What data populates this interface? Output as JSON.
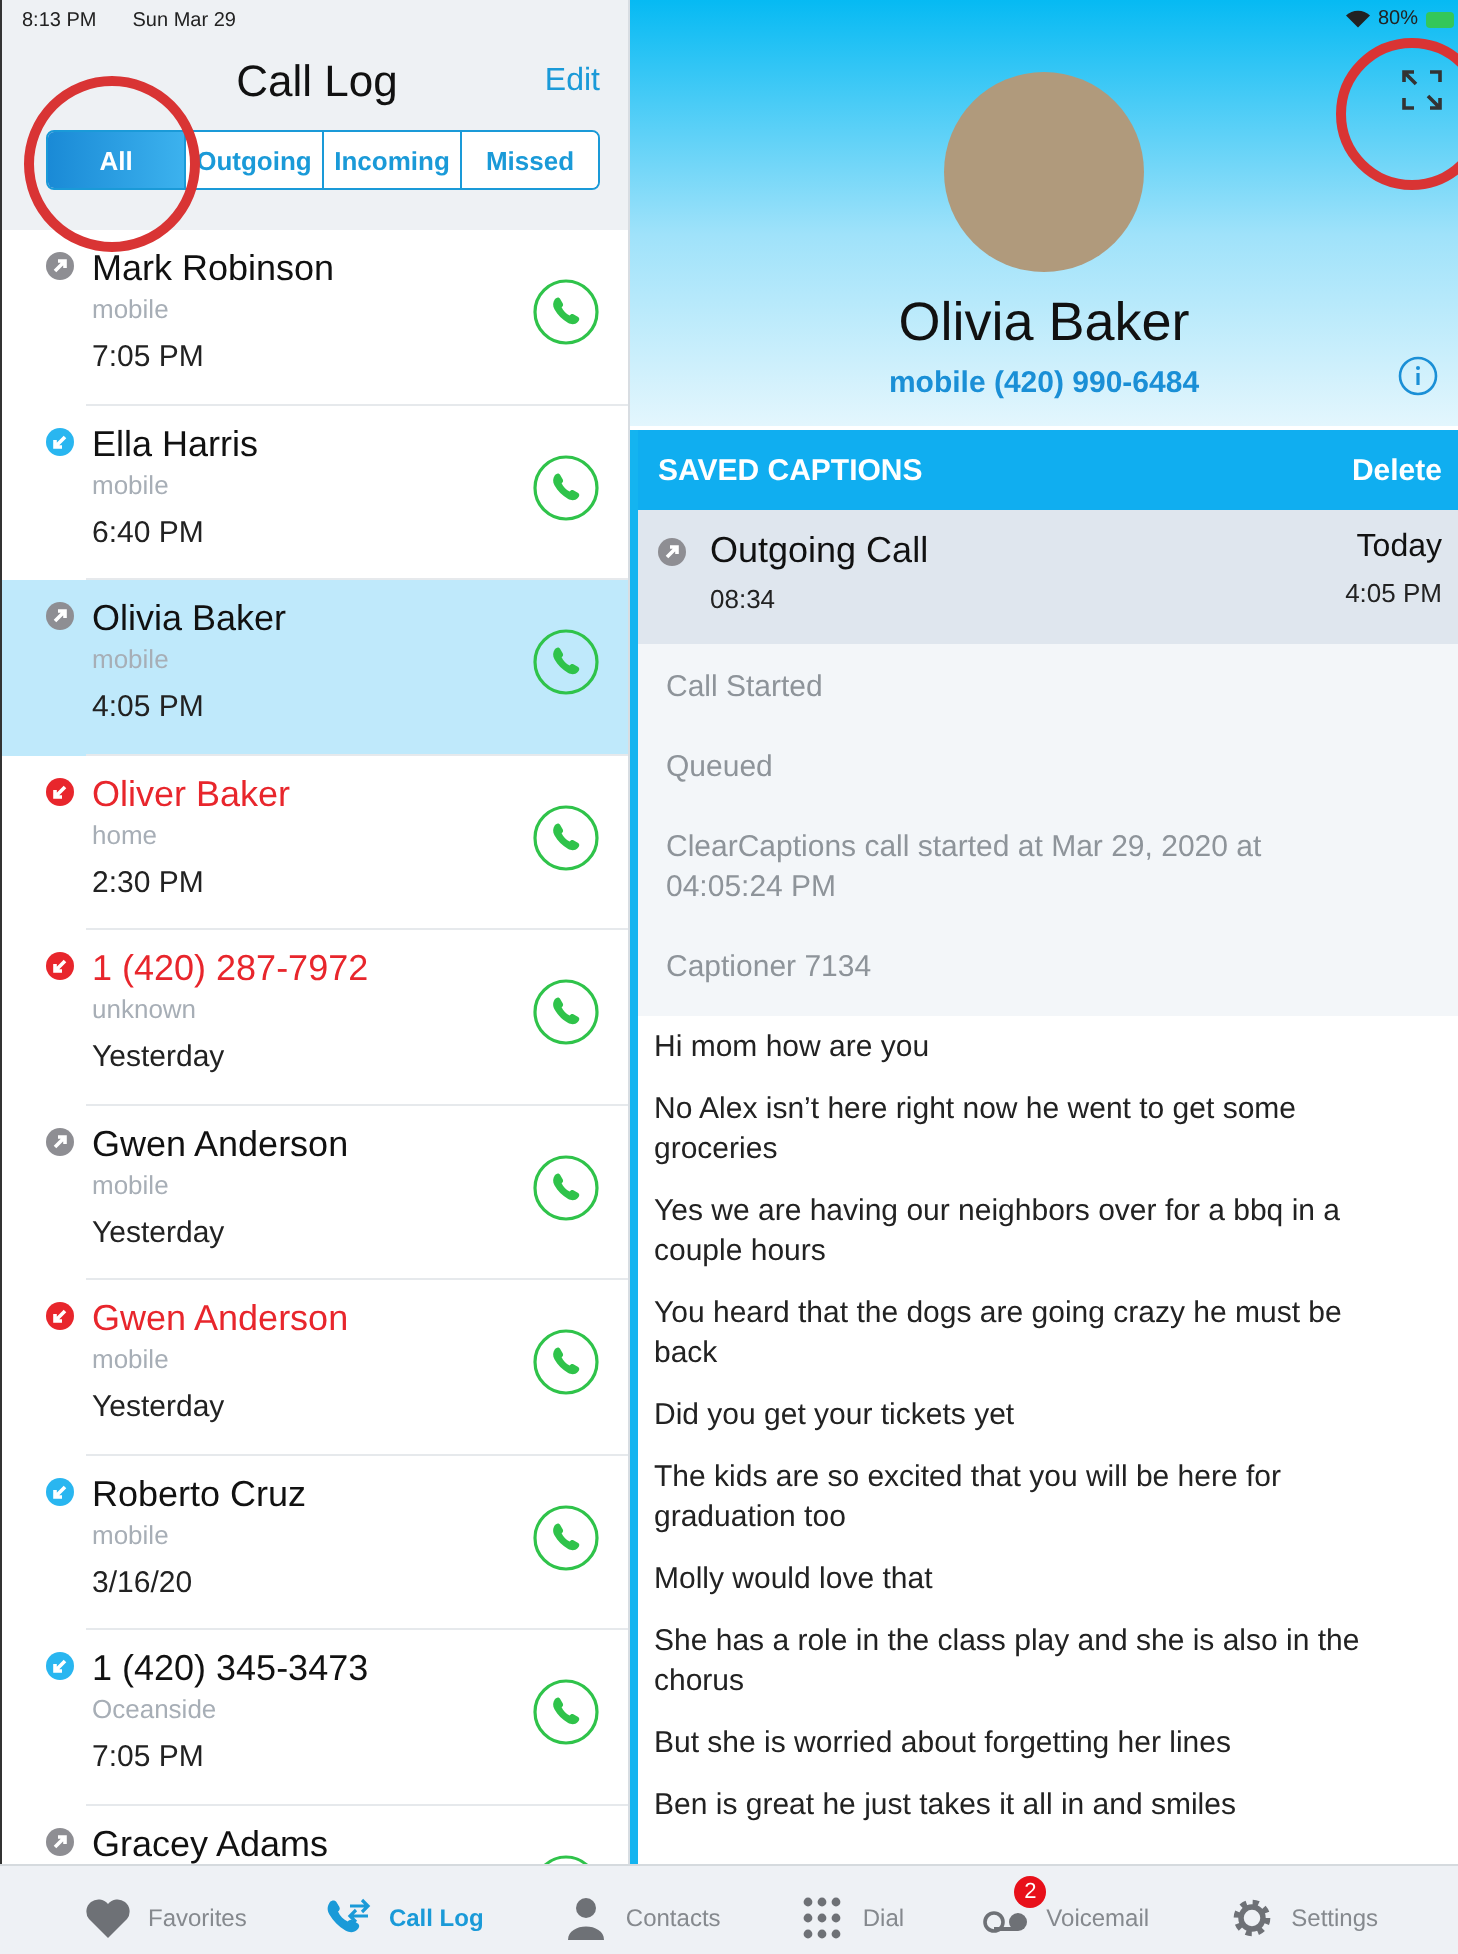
{
  "status_bar": {
    "time": "8:13 PM",
    "date": "Sun Mar 29",
    "battery": "80%"
  },
  "call_log": {
    "title": "Call Log",
    "edit": "Edit",
    "filters": [
      {
        "label": "All",
        "selected": true
      },
      {
        "label": "Outgoing",
        "selected": false
      },
      {
        "label": "Incoming",
        "selected": false
      },
      {
        "label": "Missed",
        "selected": false
      }
    ],
    "calls": [
      {
        "kind": "outgoing",
        "name": "Mark Robinson",
        "type": "mobile",
        "time": "7:05 PM",
        "selected": false
      },
      {
        "kind": "incoming",
        "name": "Ella Harris",
        "type": "mobile",
        "time": "6:40 PM",
        "selected": false
      },
      {
        "kind": "outgoing",
        "name": "Olivia Baker",
        "type": "mobile",
        "time": "4:05 PM",
        "selected": true
      },
      {
        "kind": "missed",
        "name": "Oliver Baker",
        "type": "home",
        "time": "2:30 PM",
        "selected": false
      },
      {
        "kind": "missed",
        "name": "1 (420) 287-7972",
        "type": "unknown",
        "time": "Yesterday",
        "selected": false
      },
      {
        "kind": "outgoing",
        "name": "Gwen Anderson",
        "type": "mobile",
        "time": "Yesterday",
        "selected": false
      },
      {
        "kind": "missed",
        "name": "Gwen Anderson",
        "type": "mobile",
        "time": "Yesterday",
        "selected": false
      },
      {
        "kind": "incoming",
        "name": "Roberto Cruz",
        "type": "mobile",
        "time": "3/16/20",
        "selected": false
      },
      {
        "kind": "incoming",
        "name": "1 (420) 345-3473",
        "type": "Oceanside",
        "time": "7:05 PM",
        "selected": false
      },
      {
        "kind": "outgoing",
        "name": "Gracey Adams",
        "selected": false
      }
    ]
  },
  "contact": {
    "name": "Olivia Baker",
    "phone": "mobile (420) 990-6484"
  },
  "saved_captions": {
    "title": "SAVED CAPTIONS",
    "delete": "Delete",
    "call": {
      "kind": "outgoing",
      "label": "Outgoing Call",
      "duration": "08:34",
      "day": "Today",
      "time": "4:05 PM"
    },
    "events": [
      "Call Started",
      "Queued",
      "ClearCaptions call started at Mar 29, 2020 at 04:05:24 PM",
      "Captioner 7134"
    ],
    "captions": [
      "Hi mom how are you",
      "No Alex isn’t here right now he went to get some groceries",
      "Yes we are having our neighbors over for a bbq in a couple hours",
      "You heard that the dogs are going crazy he must be back",
      "Did you get your tickets yet",
      "The kids are so excited that you will be here for graduation too",
      "Molly would love that",
      "She has a role in the class play and she is also in the chorus",
      "But she is worried about forgetting her lines",
      "Ben is great he just takes it all in and smiles"
    ]
  },
  "tab_bar": [
    {
      "kind": "favorites",
      "label": "Favorites",
      "selected": false
    },
    {
      "kind": "calllog",
      "label": "Call Log",
      "selected": true
    },
    {
      "kind": "contacts",
      "label": "Contacts",
      "selected": false
    },
    {
      "kind": "dial",
      "label": "Dial",
      "selected": false
    },
    {
      "kind": "voicemail",
      "label": "Voicemail",
      "selected": false,
      "badge": "2"
    },
    {
      "kind": "settings",
      "label": "Settings",
      "selected": false
    }
  ]
}
